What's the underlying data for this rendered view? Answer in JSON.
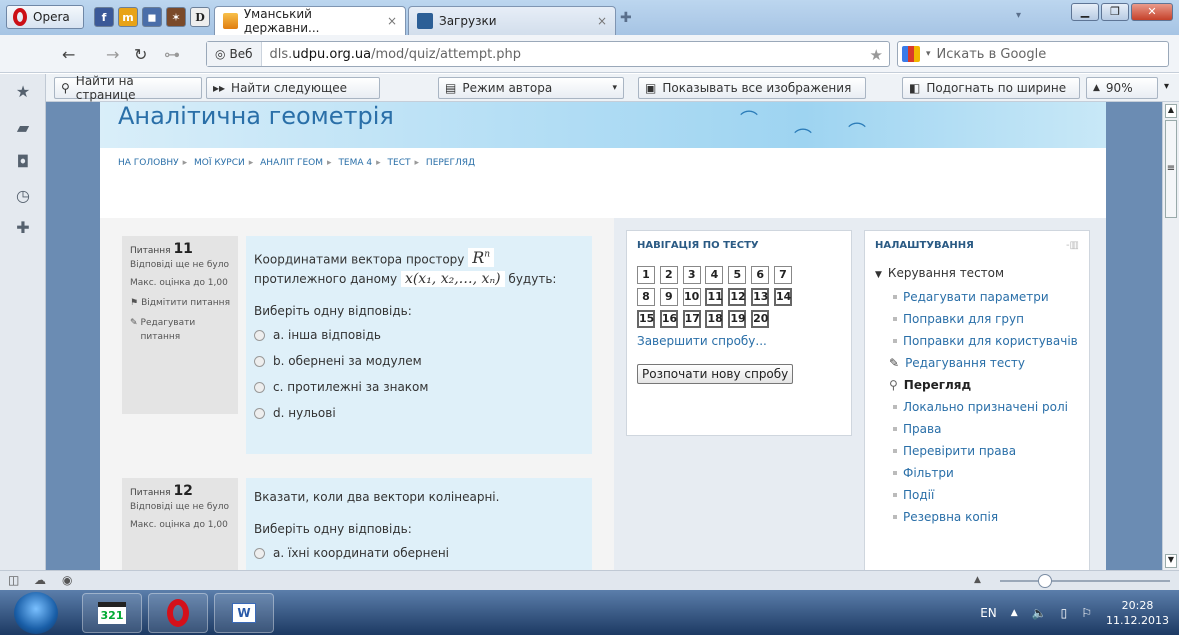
{
  "browser": {
    "menu_label": "Opera",
    "tabs": [
      {
        "label": "Уманський державни...",
        "active": true
      },
      {
        "label": "Загрузки",
        "active": false
      }
    ],
    "address": {
      "badge": "Веб",
      "url_prefix": "dls.",
      "url_domain": "udpu.org.ua",
      "url_path": "/mod/quiz/attempt.php"
    },
    "search_placeholder": "Искать в Google",
    "findbar": {
      "find_placeholder": "Найти на странице",
      "find_next": "Найти следующее",
      "author_mode": "Режим автора",
      "show_images": "Показывать все изображения",
      "fit_width": "Подогнать по ширине",
      "zoom": "90%"
    }
  },
  "page": {
    "site_title": "Аналітична геометрія",
    "breadcrumb": [
      "НА ГОЛОВНУ",
      "МОЇ КУРСИ",
      "АНАЛІТ ГЕОМ",
      "ТЕМА 4",
      "ТЕСТ",
      "ПЕРЕГЛЯД"
    ],
    "questions": [
      {
        "label": "Питання",
        "number": "11",
        "status": "Відповіді ще не було",
        "max_grade": "Макс. оцінка до 1,00",
        "flag": "Відмітити питання",
        "edit": "Редагувати питання",
        "text_a": "Координатами вектора простору",
        "text_b": "протилежного даному",
        "text_c": "будуть:",
        "math_space": "R",
        "math_space_sup": "n",
        "math_vector": "x(x₁, x₂,…, xₙ)",
        "choose": "Виберіть одну відповідь:",
        "options": [
          "a. інша відповідь",
          "b. обернені за модулем",
          "c. протилежні за знаком",
          "d. нульові"
        ]
      },
      {
        "label": "Питання",
        "number": "12",
        "status": "Відповіді ще не було",
        "max_grade": "Макс. оцінка до 1,00",
        "text": "Вказати, коли два вектори колінеарні.",
        "choose": "Виберіть одну відповідь:",
        "options": [
          "a. їхні координати обернені"
        ]
      }
    ],
    "nav_block": {
      "title": "НАВІГАЦІЯ ПО ТЕСТУ",
      "buttons": [
        "1",
        "2",
        "3",
        "4",
        "5",
        "6",
        "7",
        "8",
        "9",
        "10",
        "11",
        "12",
        "13",
        "14",
        "15",
        "16",
        "17",
        "18",
        "19",
        "20"
      ],
      "finish": "Завершити спробу...",
      "start_new": "Розпочати нову спробу"
    },
    "settings_block": {
      "title": "НАЛАШТУВАННЯ",
      "section": "Керування тестом",
      "items": [
        "Редагувати параметри",
        "Поправки для груп",
        "Поправки для користувачів",
        "Редагування тесту",
        "Перегляд",
        "Локально призначені ролі",
        "Права",
        "Перевірити права",
        "Фільтри",
        "Події",
        "Резервна копія"
      ]
    }
  },
  "taskbar": {
    "lang": "EN",
    "time": "20:28",
    "date": "11.12.2013",
    "media_app_label": "321"
  }
}
